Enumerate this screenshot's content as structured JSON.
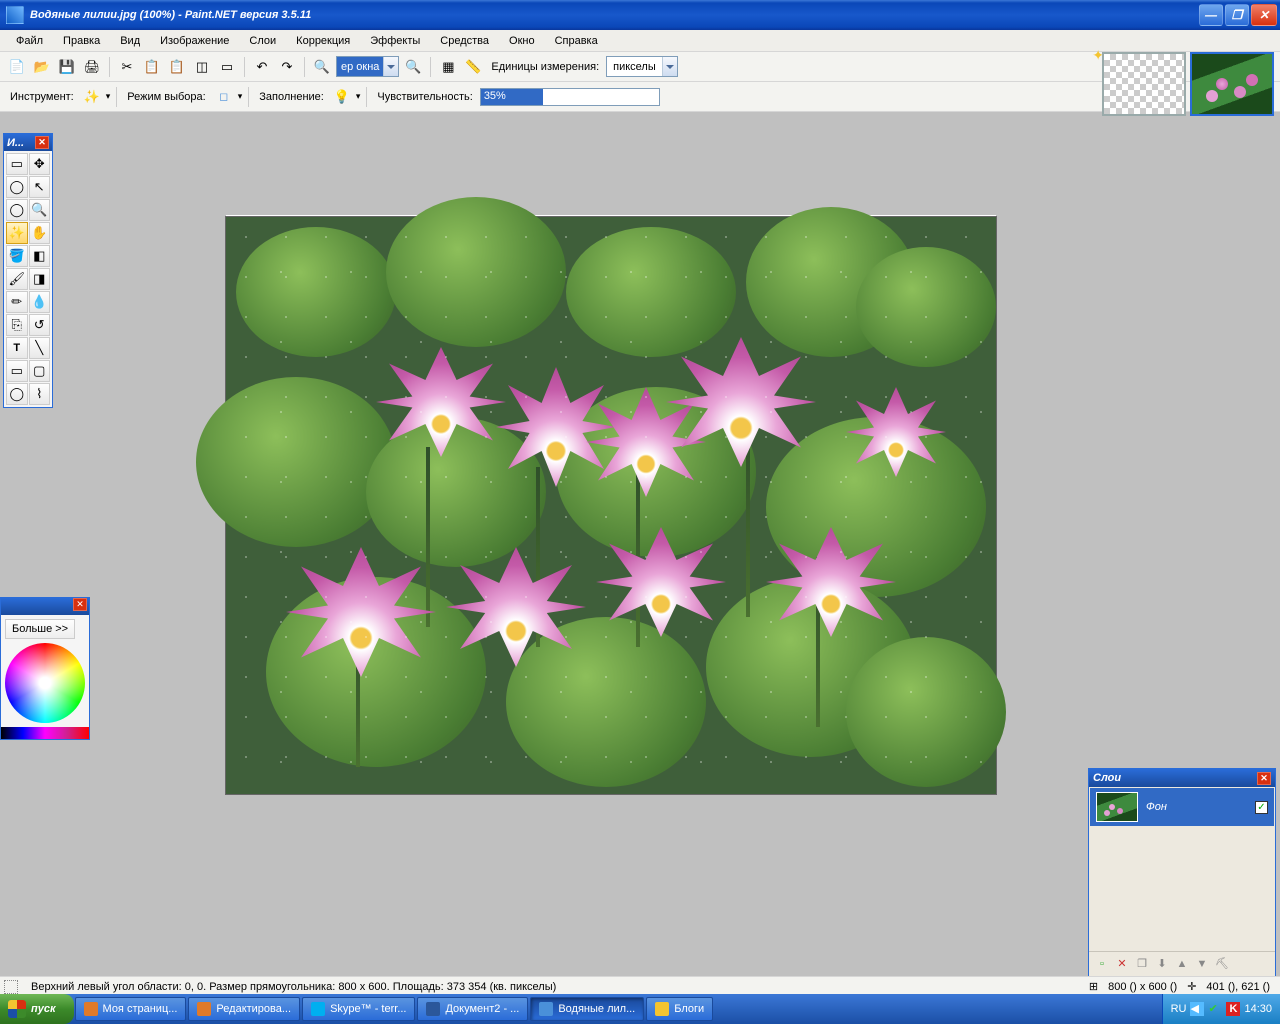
{
  "title": "Водяные лилии.jpg (100%) - Paint.NET версия 3.5.11",
  "menu": [
    "Файл",
    "Правка",
    "Вид",
    "Изображение",
    "Слои",
    "Коррекция",
    "Эффекты",
    "Средства",
    "Окно",
    "Справка"
  ],
  "toolbar1": {
    "zoom_combo": "ер окна",
    "units_label": "Единицы измерения:",
    "units_value": "пикселы"
  },
  "toolbar2": {
    "tool_label": "Инструмент:",
    "mode_label": "Режим выбора:",
    "fill_label": "Заполнение:",
    "sens_label": "Чувствительность:",
    "sens_value": "35%"
  },
  "tools_title": "И...",
  "colors": {
    "more": "Больше >>"
  },
  "layers": {
    "title": "Слои",
    "row_name": "Фон"
  },
  "status": {
    "sel": "Верхний левый угол области: 0, 0. Размер прямоугольника: 800 x 600. Площадь: 373 354 (кв. пикселы)",
    "size": "800 () x 600 ()",
    "pos": "401 (), 621 ()"
  },
  "taskbar": {
    "start": "пуск",
    "items": [
      "Моя страниц...",
      "Редактирова...",
      "Skype™ - terr...",
      "Документ2 - ...",
      "Водяные лил...",
      "Блоги"
    ],
    "lang": "RU",
    "clock": "14:30"
  }
}
